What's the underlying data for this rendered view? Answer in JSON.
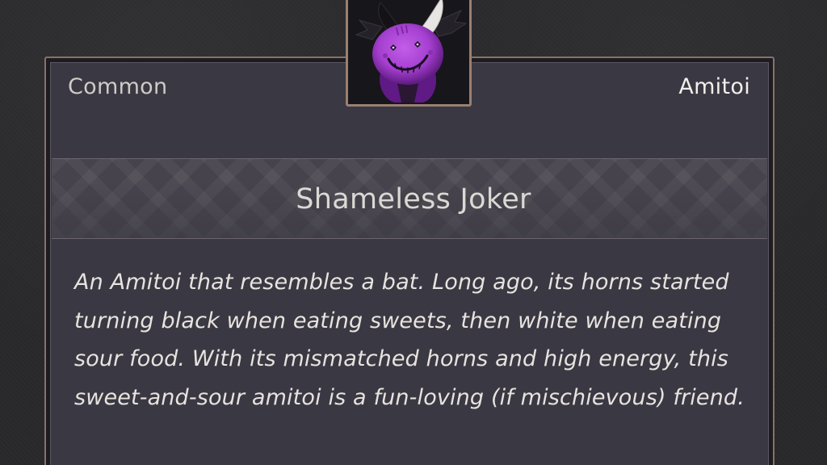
{
  "card": {
    "rarity": "Common",
    "item_type": "Amitoi",
    "name": "Shameless Joker",
    "description": "An Amitoi that resembles a bat. Long ago, its horns started turning black when eating sweets, then white when eating sour food. With its mismatched horns and high energy, this sweet-and-sour amitoi is a fun-loving (if mischievous) friend."
  },
  "portrait": {
    "icon": "bat-amitoi-plush-icon",
    "colors": {
      "body": "#a53fd0",
      "body_shadow": "#6b1f8e",
      "horn_left": "#141216",
      "horn_right": "#e8e6e4",
      "wings": "#242128"
    }
  },
  "colors": {
    "frame_accent": "#9a8071",
    "panel": "#3a3842",
    "text_primary": "#e7e3df"
  }
}
